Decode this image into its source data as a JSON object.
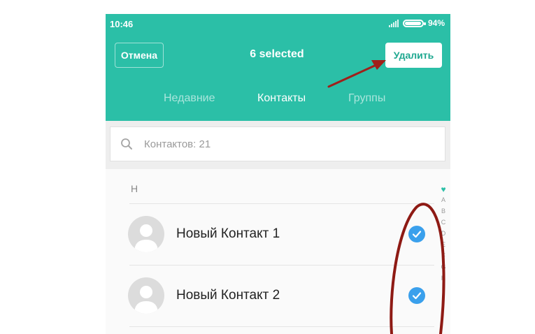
{
  "status_bar": {
    "time": "10:46",
    "battery": "94%",
    "battery_level": 0.94
  },
  "header": {
    "cancel_label": "Отмена",
    "title": "6 selected",
    "delete_label": "Удалить"
  },
  "tabs": [
    {
      "label": "Недавние",
      "active": false
    },
    {
      "label": "Контакты",
      "active": true
    },
    {
      "label": "Группы",
      "active": false
    }
  ],
  "search": {
    "placeholder": "Контактов: 21"
  },
  "list": {
    "section_letter": "Н",
    "contacts": [
      {
        "name": "Новый Контакт 1",
        "selected": true
      },
      {
        "name": "Новый Контакт 2",
        "selected": true
      }
    ]
  },
  "alpha_index": {
    "favorites_icon": "heart-icon",
    "letters": [
      "A",
      "B",
      "C",
      "D",
      "E",
      "F",
      "G",
      "H",
      "I",
      "J"
    ]
  },
  "colors": {
    "accent": "#2bbfa7",
    "check": "#3aa0ec",
    "annotation": "#a0201a"
  }
}
